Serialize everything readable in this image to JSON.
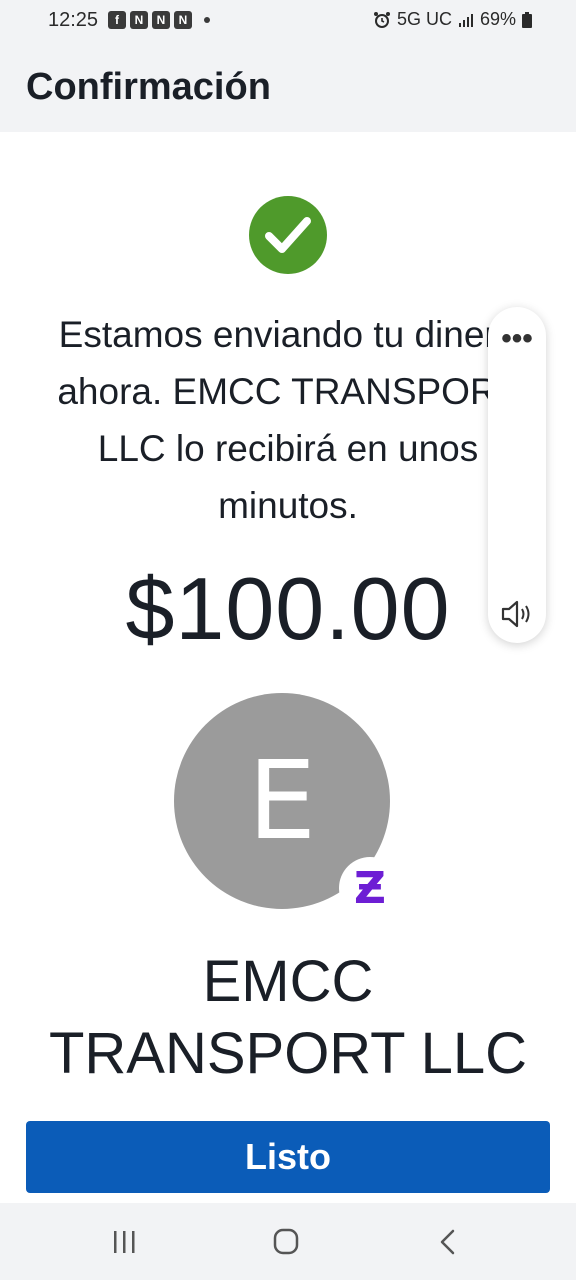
{
  "status_bar": {
    "time": "12:25",
    "network": "5G UC",
    "battery": "69%"
  },
  "header": {
    "title": "Confirmación"
  },
  "confirmation": {
    "message": "Estamos enviando tu dinero ahora. EMCC TRANSPORT LLC lo recibirá en unos minutos.",
    "amount": "$100.00"
  },
  "recipient": {
    "initial": "E",
    "name": "EMCC TRANSPORT LLC",
    "badge_glyph": "Ƶ"
  },
  "actions": {
    "done_label": "Listo"
  },
  "side_panel": {
    "more_glyph": "•••"
  },
  "colors": {
    "success": "#4f9a2b",
    "primary": "#0b5cb8",
    "zelle": "#6d1ed4",
    "avatar": "#9b9b9b"
  },
  "icons": {
    "success": "check-circle-icon",
    "more": "more-options-icon",
    "speaker": "speaker-icon",
    "badge": "zelle-icon"
  }
}
